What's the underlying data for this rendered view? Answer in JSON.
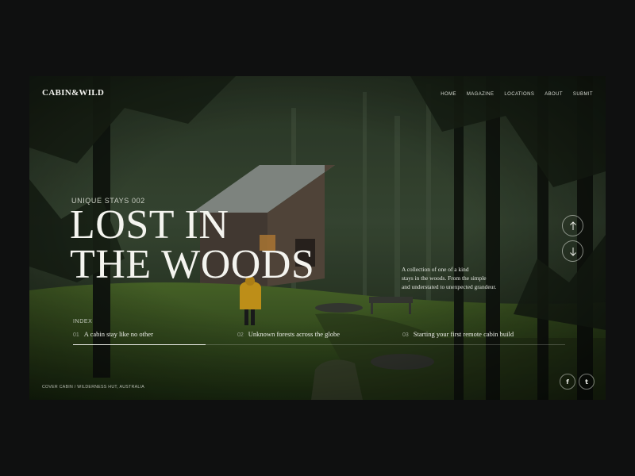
{
  "brand": {
    "logo": "CABIN&WILD"
  },
  "nav": {
    "items": [
      "HOME",
      "MAGAZINE",
      "LOCATIONS",
      "ABOUT",
      "SUBMIT"
    ]
  },
  "hero": {
    "eyebrow": "UNIQUE STAYS 002",
    "headline_line1": "LOST IN",
    "headline_line2": "THE WOODS",
    "blurb_line1": "A collection of one of a kind",
    "blurb_line2": "stays in the woods. From the simple",
    "blurb_line3": "and understated to unexpected grandeur."
  },
  "controls": {
    "up_icon": "arrow-up-icon",
    "down_icon": "arrow-down-icon"
  },
  "index": {
    "label": "INDEX",
    "items": [
      {
        "num": "01",
        "title": "A cabin stay like no other"
      },
      {
        "num": "02",
        "title": "Unknown forests across the globe"
      },
      {
        "num": "03",
        "title": "Starting your first remote cabin build"
      }
    ],
    "active_progress": 0.27
  },
  "caption": "COVER CABIN /  WILDERNESS HUT, AUSTRALIA",
  "social": {
    "facebook": "f",
    "twitter": "t"
  },
  "colors": {
    "page_bg": "#0f1010",
    "forest_dark": "#1a2418",
    "moss": "#4d6b2c",
    "jacket": "#d8a21c",
    "text": "#f4f4ef"
  }
}
